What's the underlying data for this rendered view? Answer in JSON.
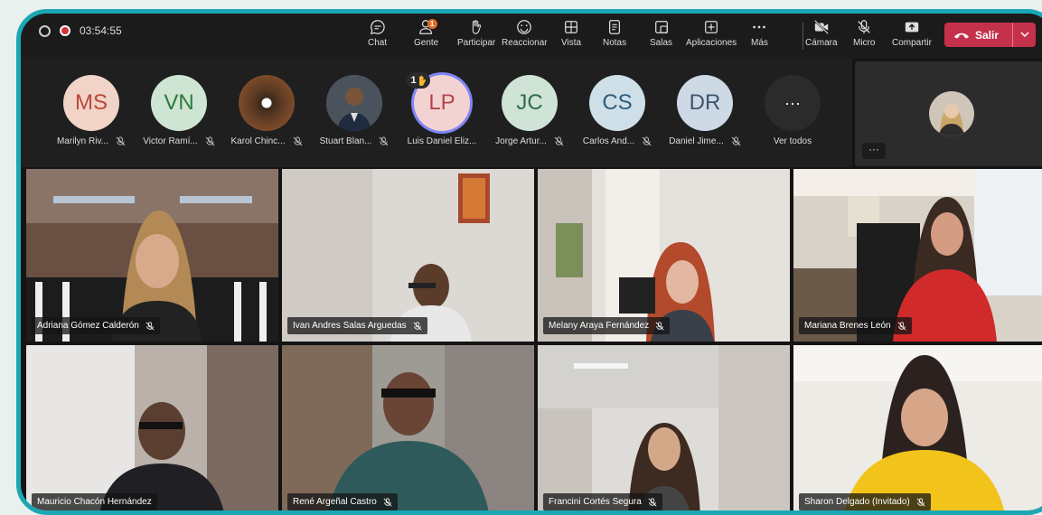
{
  "timer": "03:54:55",
  "toolbar": [
    {
      "label": "Chat",
      "icon": "chat-icon"
    },
    {
      "label": "Gente",
      "icon": "people-icon",
      "badge": "1"
    },
    {
      "label": "Participar",
      "icon": "raise-hand-icon"
    },
    {
      "label": "Reaccionar",
      "icon": "emoji-icon"
    },
    {
      "label": "Vista",
      "icon": "grid-icon"
    },
    {
      "label": "Notas",
      "icon": "notes-icon"
    },
    {
      "label": "Salas",
      "icon": "rooms-icon"
    },
    {
      "label": "Aplicaciones",
      "icon": "add-apps-icon"
    },
    {
      "label": "Más",
      "icon": "more-icon"
    },
    {
      "label": "Cámara",
      "icon": "camera-off-icon"
    },
    {
      "label": "Micro",
      "icon": "mic-off-icon"
    },
    {
      "label": "Compartir",
      "icon": "share-icon"
    }
  ],
  "leave_label": "Salir",
  "participants": [
    {
      "initials": "MS",
      "name": "Marilyn Riv...",
      "color": "#f1d3c8"
    },
    {
      "initials": "VN",
      "name": "Victor Ramí...",
      "color": "#cfe5d3"
    },
    {
      "initials": "",
      "name": "Karol Chinc...",
      "color": "#5b3a22"
    },
    {
      "initials": "",
      "name": "Stuart Blan...",
      "color": "#56606a"
    },
    {
      "initials": "LP",
      "name": "Luis Daniel Eliz...",
      "color": "#f3d3d2",
      "hand": "1"
    },
    {
      "initials": "JC",
      "name": "Jorge Artur...",
      "color": "#cfe3d6"
    },
    {
      "initials": "CS",
      "name": "Carlos And...",
      "color": "#cfdfe8"
    },
    {
      "initials": "DR",
      "name": "Daniel Jime...",
      "color": "#cdd9e4"
    }
  ],
  "view_all": "Ver todos",
  "more_label": "···",
  "videos": [
    {
      "name": "Adriana Gómez Calderón",
      "muted": true
    },
    {
      "name": "Ivan Andres Salas Arguedas",
      "muted": true
    },
    {
      "name": "Melany Araya Fernández",
      "muted": true
    },
    {
      "name": "Mariana Brenes León",
      "muted": true
    },
    {
      "name": "Mauricio Chacón Hernández",
      "muted": false
    },
    {
      "name": "René Argeñal Castro",
      "muted": true
    },
    {
      "name": "Francini Cortés Segura",
      "muted": true
    },
    {
      "name": "Sharon Delgado (Invitado)",
      "muted": true
    }
  ],
  "colors": {
    "accent": "#1ba7b3",
    "leave": "#c4314b",
    "record": "#d13438"
  }
}
